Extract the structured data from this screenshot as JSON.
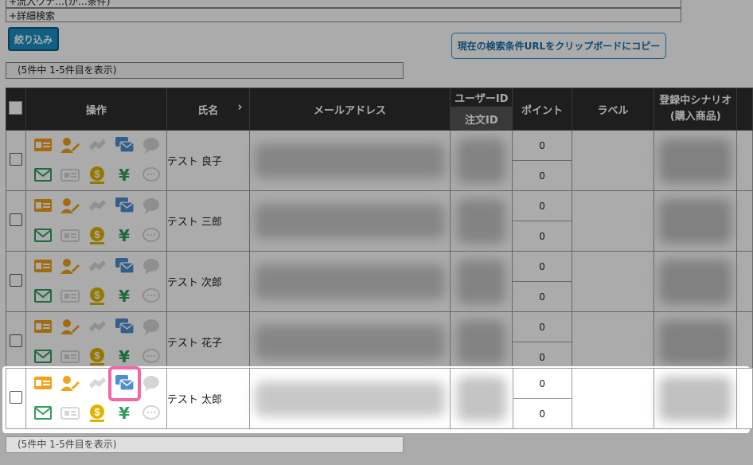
{
  "filters": {
    "top_cut_label": "+流入ワナ…(か…条件)",
    "detail_search_label": "+詳細検索"
  },
  "buttons": {
    "filter_label": "絞り込み",
    "copy_url_label": "現在の検索条件URLをクリップボードにコピー"
  },
  "pagination": {
    "top_text": "(5件中 1-5件目を表示)",
    "bottom_text": "(5件中 1-5件目を表示)"
  },
  "table": {
    "headers": {
      "operations": "操作",
      "name": "氏名",
      "name_sort_arrow": "›",
      "email": "メールアドレス",
      "user_id": "ユーザーID",
      "order_id": "注文ID",
      "points": "ポイント",
      "label": "ラベル",
      "scenario": "登録中シナリオ",
      "scenario_sub": "(購入商品)"
    },
    "rows": [
      {
        "name": "テスト 良子",
        "point1": "0",
        "point2": "0"
      },
      {
        "name": "テスト 三郎",
        "point1": "0",
        "point2": "0"
      },
      {
        "name": "テスト 次郎",
        "point1": "0",
        "point2": "0"
      },
      {
        "name": "テスト 花子",
        "point1": "0",
        "point2": "0"
      },
      {
        "name": "テスト 太郎",
        "point1": "0",
        "point2": "0"
      }
    ]
  },
  "icons": [
    "id-card-icon",
    "user-edit-icon",
    "handshake-icon",
    "email-forward-icon",
    "chat-bubble-icon",
    "mail-icon",
    "ticket-icon",
    "coin-icon",
    "yen-icon",
    "chat-outline-icon"
  ],
  "colors": {
    "accent_orange": "#f0a21a",
    "icon_blue": "#4c8fd0",
    "icon_green": "#2e9e5b",
    "icon_gold": "#e0b400",
    "highlight_pink": "#f06aa9",
    "header_dark": "#2d2d2d",
    "button_blue": "#1a8fc5"
  }
}
